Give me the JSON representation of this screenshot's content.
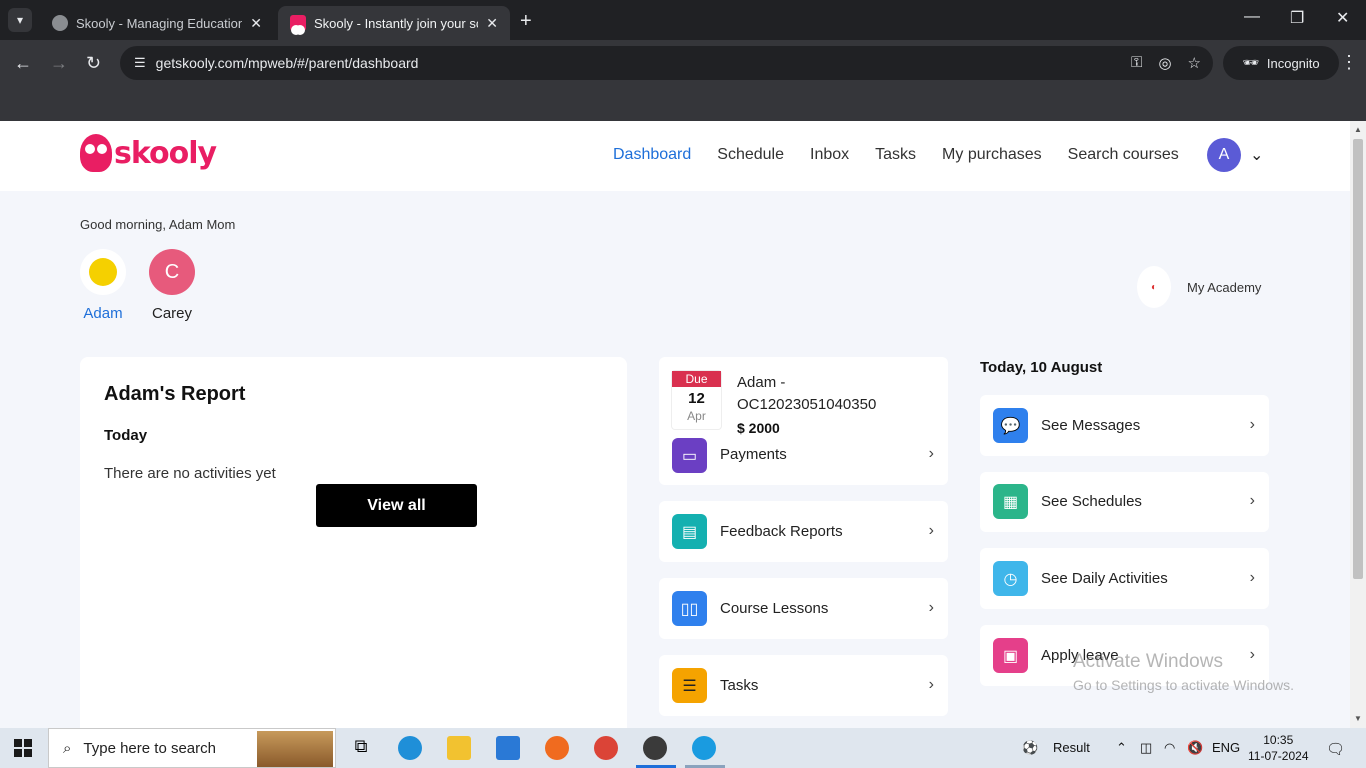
{
  "browser": {
    "tabs": [
      {
        "title": "Skooly - Managing Educational",
        "active": false
      },
      {
        "title": "Skooly - Instantly join your scho",
        "active": true
      }
    ],
    "url": "getskooly.com/mpweb/#/parent/dashboard",
    "incognito_label": "Incognito"
  },
  "header": {
    "logo_text": "skooly",
    "nav": [
      "Dashboard",
      "Schedule",
      "Inbox",
      "Tasks",
      "My purchases",
      "Search courses"
    ],
    "active_nav": "Dashboard",
    "avatar_letter": "A"
  },
  "greeting": "Good morning, Adam Mom",
  "children": [
    {
      "name": "Adam",
      "initial": ""
    },
    {
      "name": "Carey",
      "initial": "C"
    }
  ],
  "academy": {
    "name": "My Academy"
  },
  "report": {
    "title": "Adam's Report",
    "period": "Today",
    "empty_text": "There are no activities yet",
    "button": "View all"
  },
  "payment": {
    "due_label": "Due",
    "due_day": "12",
    "due_month": "Apr",
    "title": "Adam - OC12023051040350",
    "amount": "$ 2000",
    "link": "Payments"
  },
  "middle_cards": [
    "Feedback Reports",
    "Course Lessons",
    "Tasks"
  ],
  "date_heading": "Today, 10 August",
  "right_cards": [
    "See Messages",
    "See Schedules",
    "See Daily Activities",
    "Apply leave"
  ],
  "watermark": {
    "line1": "Activate Windows",
    "line2": "Go to Settings to activate Windows."
  },
  "taskbar": {
    "search_placeholder": "Type here to search",
    "weather": "Result",
    "lang": "ENG",
    "time": "10:35",
    "date": "11-07-2024"
  },
  "colors": {
    "brand": "#e91e63",
    "nav_active": "#1e6fd9",
    "payment_icon": "#6b3fc3",
    "feedback_icon": "#14b0b0",
    "lessons_icon": "#2f80ed",
    "tasks_icon": "#f5a300",
    "messages_icon": "#2f80ed",
    "schedules_icon": "#2bb58a",
    "activities_icon": "#3fb6ea",
    "leave_icon": "#e53f8a"
  }
}
